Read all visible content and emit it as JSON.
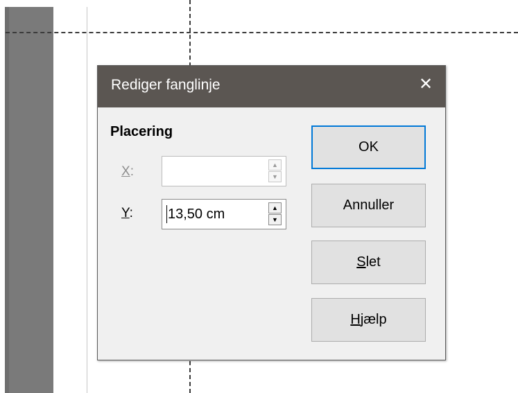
{
  "dialog": {
    "title": "Rediger fanglinje",
    "close_glyph": "✕",
    "section": "Placering",
    "x_field": {
      "label_mnemonic": "X",
      "label_rest": ":",
      "value": "",
      "enabled": false
    },
    "y_field": {
      "label_mnemonic": "Y",
      "label_rest": ":",
      "value": "13,50 cm",
      "enabled": true
    },
    "buttons": {
      "ok": "OK",
      "cancel": "Annuller",
      "delete_mnemonic": "S",
      "delete_rest": "let",
      "help_mnemonic": "H",
      "help_rest": "jælp"
    },
    "spin_up_glyph": "▲",
    "spin_down_glyph": "▼"
  },
  "colors": {
    "titlebar": "#5b5652",
    "dialog_bg": "#f0f0f0",
    "default_button_border": "#0078d7",
    "button_bg": "#e1e1e1"
  }
}
